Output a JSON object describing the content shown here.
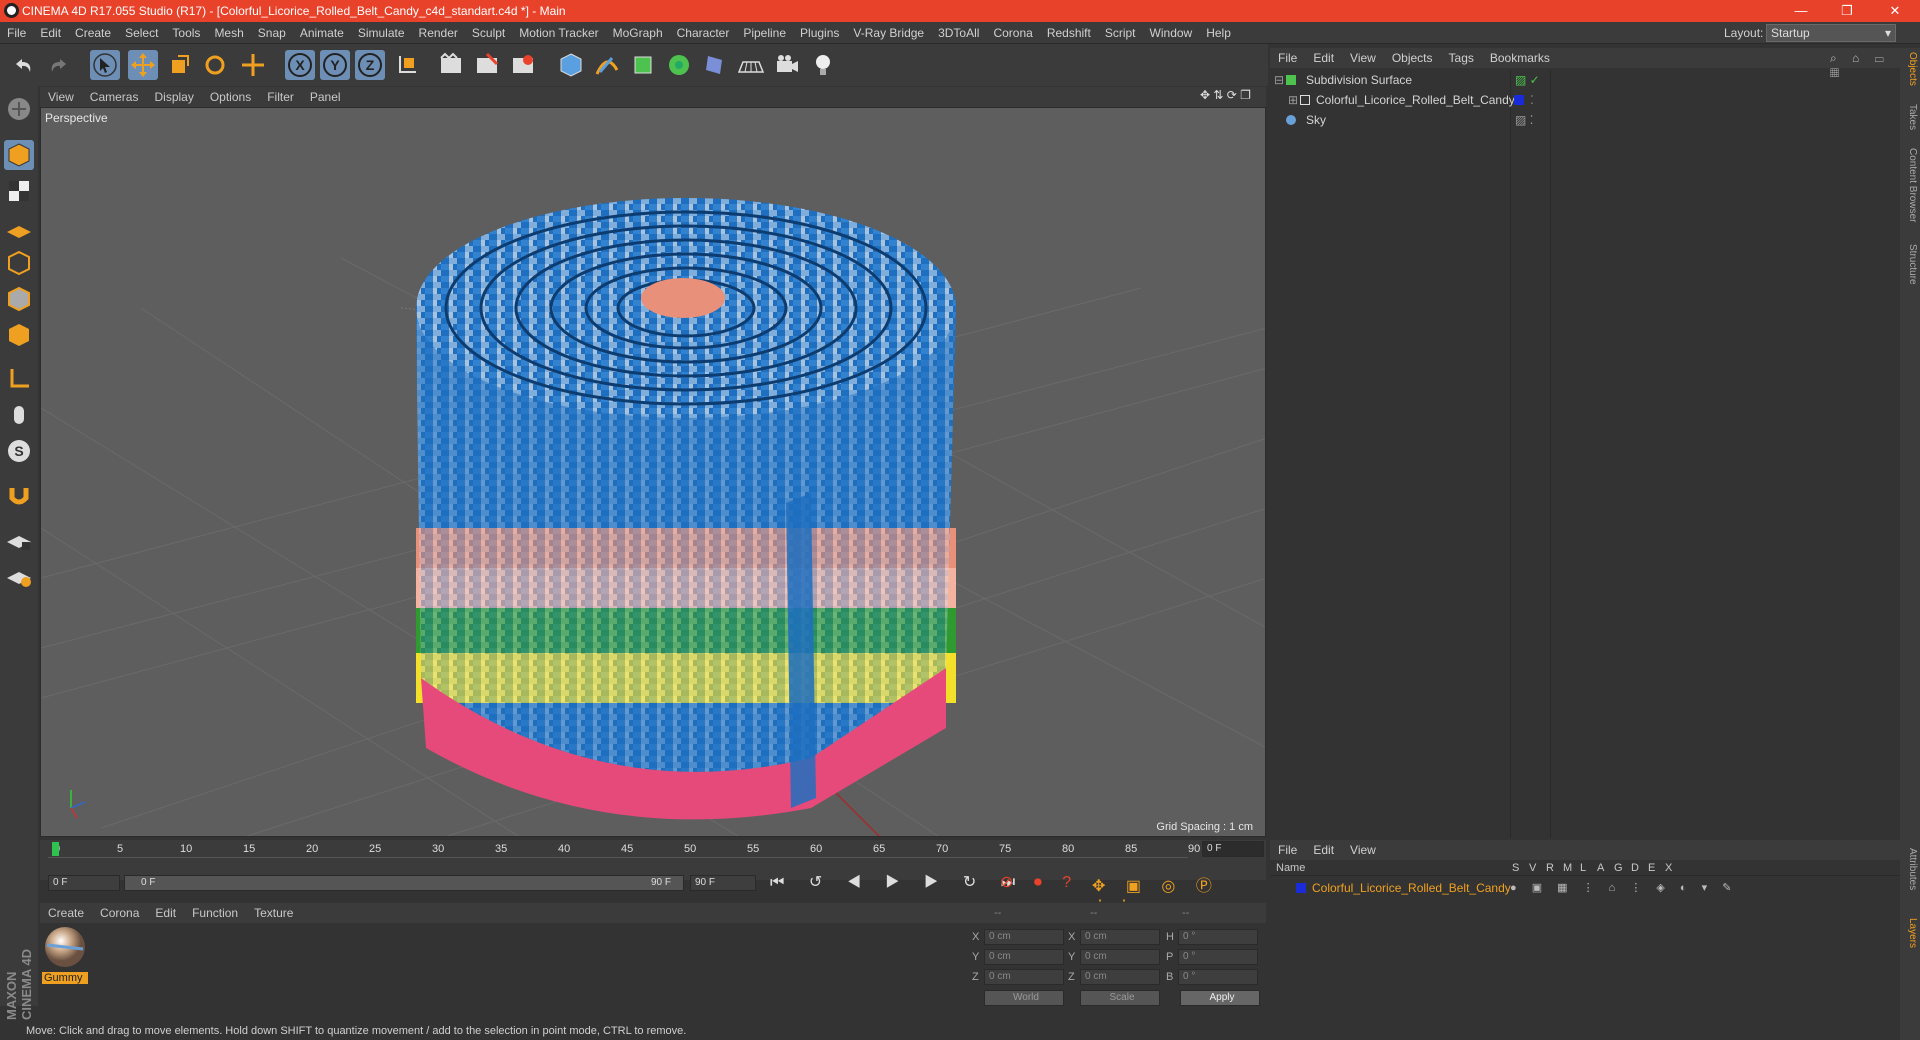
{
  "window": {
    "title": "CINEMA 4D R17.055 Studio (R17) - [Colorful_Licorice_Rolled_Belt_Candy_c4d_standart.c4d *] - Main"
  },
  "menubar": [
    "File",
    "Edit",
    "Create",
    "Select",
    "Tools",
    "Mesh",
    "Snap",
    "Animate",
    "Simulate",
    "Render",
    "Sculpt",
    "Motion Tracker",
    "MoGraph",
    "Character",
    "Pipeline",
    "Plugins",
    "V-Ray Bridge",
    "3DToAll",
    "Corona",
    "Redshift",
    "Script",
    "Window",
    "Help"
  ],
  "layout": {
    "label": "Layout:",
    "value": "Startup"
  },
  "viewport": {
    "menu": [
      "View",
      "Cameras",
      "Display",
      "Options",
      "Filter",
      "Panel"
    ],
    "label": "Perspective",
    "grid_spacing": "Grid Spacing : 1 cm"
  },
  "timeline": {
    "ticks": [
      "0",
      "5",
      "10",
      "15",
      "20",
      "25",
      "30",
      "35",
      "40",
      "45",
      "50",
      "55",
      "60",
      "65",
      "70",
      "75",
      "80",
      "85",
      "90"
    ],
    "current": "0 F",
    "start": "0 F",
    "range_start": "0 F",
    "range_end": "90 F",
    "end": "90 F"
  },
  "material": {
    "menu": [
      "Create",
      "Corona",
      "Edit",
      "Function",
      "Texture"
    ],
    "items": [
      {
        "name": "Gummy"
      }
    ]
  },
  "coords": {
    "header": [
      "--",
      "--",
      "--"
    ],
    "rows": [
      {
        "a": "X",
        "av": "0 cm",
        "b": "X",
        "bv": "0 cm",
        "c": "H",
        "cv": "0 °"
      },
      {
        "a": "Y",
        "av": "0 cm",
        "b": "Y",
        "bv": "0 cm",
        "c": "P",
        "cv": "0 °"
      },
      {
        "a": "Z",
        "av": "0 cm",
        "b": "Z",
        "bv": "0 cm",
        "c": "B",
        "cv": "0 °"
      }
    ],
    "world": "World",
    "scale": "Scale",
    "apply": "Apply"
  },
  "objects": {
    "menu": [
      "File",
      "Edit",
      "View",
      "Objects",
      "Tags",
      "Bookmarks"
    ],
    "items": [
      {
        "name": "Subdivision Surface",
        "color": "#4ec24e"
      },
      {
        "name": "Colorful_Licorice_Rolled_Belt_Candy",
        "color": "#1a2bd8"
      },
      {
        "name": "Sky",
        "color": "#6aa0d8"
      }
    ]
  },
  "attributes": {
    "menu": [
      "File",
      "Edit",
      "View"
    ],
    "columns": [
      "Name",
      "S",
      "V",
      "R",
      "M",
      "L",
      "A",
      "G",
      "D",
      "E",
      "X"
    ],
    "row": {
      "name": "Colorful_Licorice_Rolled_Belt_Candy",
      "color": "#f0a020"
    }
  },
  "right_tabs": [
    "Objects",
    "Takes",
    "Content Browser",
    "Structure",
    "Attributes",
    "Layers"
  ],
  "status": "Move: Click and drag to move elements. Hold down SHIFT to quantize movement / add to the selection in point mode, CTRL to remove.",
  "brand": "MAXON CINEMA 4D"
}
